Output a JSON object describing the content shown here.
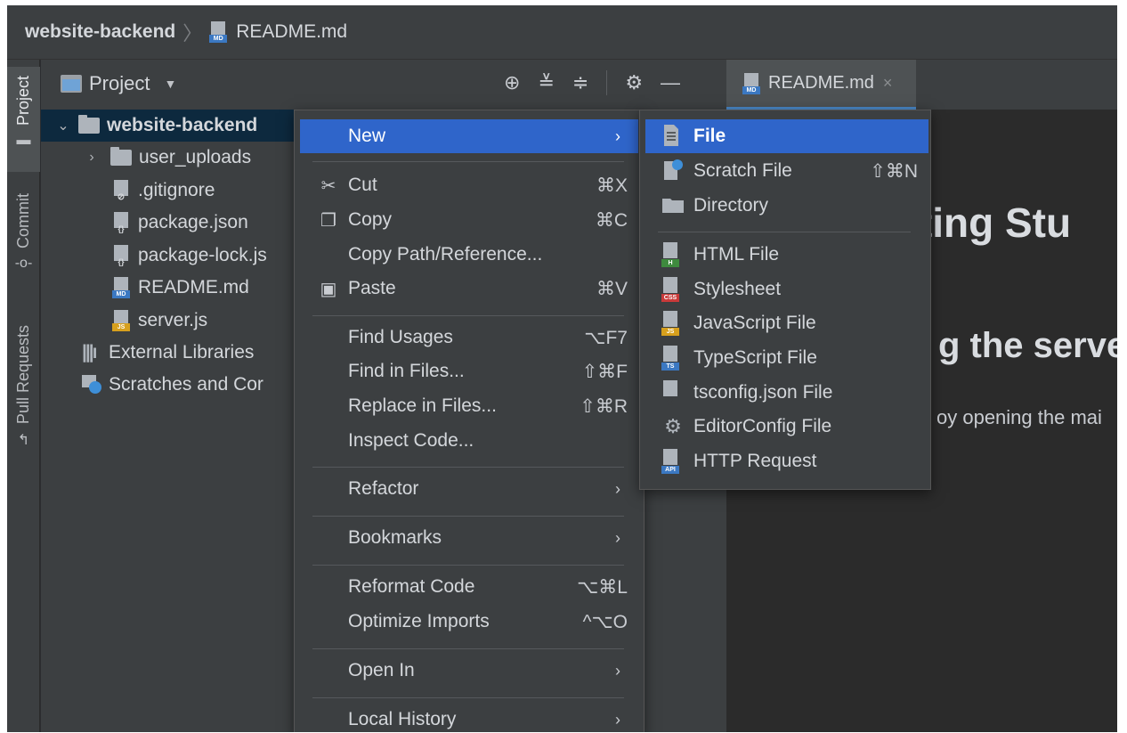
{
  "breadcrumb": {
    "root": "website-backend",
    "separator": "〉",
    "file": "README.md",
    "file_icon": "markdown-file-icon"
  },
  "stripe": {
    "project": "Project",
    "commit": "Commit",
    "pull_requests": "Pull Requests"
  },
  "project_panel": {
    "title": "Project",
    "tools": [
      "locate-icon",
      "expand-all-icon",
      "collapse-all-icon",
      "gear-icon",
      "hide-icon"
    ]
  },
  "tree": {
    "root": "website-backend",
    "items": [
      {
        "label": "user_uploads",
        "kind": "folder"
      },
      {
        "label": ".gitignore",
        "kind": "gitignore"
      },
      {
        "label": "package.json",
        "kind": "json"
      },
      {
        "label": "package-lock.js",
        "kind": "json"
      },
      {
        "label": "README.md",
        "kind": "md"
      },
      {
        "label": "server.js",
        "kind": "js"
      },
      {
        "label": "External Libraries",
        "kind": "libraries"
      },
      {
        "label": "Scratches and Cor",
        "kind": "scratches"
      }
    ]
  },
  "editor": {
    "tab_label": "README.md",
    "tab_close": "×",
    "h1": "rting Stu",
    "h2": "g the serve",
    "p": "oy opening the mai"
  },
  "context_menu": {
    "items": [
      {
        "label": "New",
        "shortcut": "",
        "submenu": true,
        "highlight": true,
        "icon": ""
      },
      {
        "label": "Cut",
        "shortcut": "⌘X",
        "icon": "✂"
      },
      {
        "label": "Copy",
        "shortcut": "⌘C",
        "icon": "❐"
      },
      {
        "label": "Copy Path/Reference...",
        "shortcut": "",
        "icon": ""
      },
      {
        "label": "Paste",
        "shortcut": "⌘V",
        "icon": "📋"
      },
      {
        "label": "Find Usages",
        "shortcut": "⌥F7",
        "icon": ""
      },
      {
        "label": "Find in Files...",
        "shortcut": "⇧⌘F",
        "icon": ""
      },
      {
        "label": "Replace in Files...",
        "shortcut": "⇧⌘R",
        "icon": ""
      },
      {
        "label": "Inspect Code...",
        "shortcut": "",
        "icon": ""
      },
      {
        "label": "Refactor",
        "shortcut": "",
        "submenu": true
      },
      {
        "label": "Bookmarks",
        "shortcut": "",
        "submenu": true
      },
      {
        "label": "Reformat Code",
        "shortcut": "⌥⌘L"
      },
      {
        "label": "Optimize Imports",
        "shortcut": "^⌥O"
      },
      {
        "label": "Open In",
        "shortcut": "",
        "submenu": true
      },
      {
        "label": "Local History",
        "shortcut": "",
        "submenu": true
      }
    ],
    "submenu_arrow": "›"
  },
  "new_submenu": {
    "items": [
      {
        "label": "File",
        "shortcut": "",
        "highlight": true,
        "icon": "file-icon"
      },
      {
        "label": "Scratch File",
        "shortcut": "⇧⌘N",
        "icon": "scratch-file-icon"
      },
      {
        "label": "Directory",
        "shortcut": "",
        "icon": "folder-icon"
      },
      {
        "label": "HTML File",
        "shortcut": "",
        "icon": "html-file-icon",
        "tag": "H",
        "tag_color": "#3e8a3e"
      },
      {
        "label": "Stylesheet",
        "shortcut": "",
        "icon": "css-file-icon",
        "tag": "CSS",
        "tag_color": "#c93a3a"
      },
      {
        "label": "JavaScript File",
        "shortcut": "",
        "icon": "js-file-icon",
        "tag": "JS",
        "tag_color": "#d7a01d"
      },
      {
        "label": "TypeScript File",
        "shortcut": "",
        "icon": "ts-file-icon",
        "tag": "TS",
        "tag_color": "#3b78c2"
      },
      {
        "label": "tsconfig.json File",
        "shortcut": "",
        "icon": "json-file-icon"
      },
      {
        "label": "EditorConfig File",
        "shortcut": "",
        "icon": "gear-icon"
      },
      {
        "label": "HTTP Request",
        "shortcut": "",
        "icon": "api-file-icon",
        "tag": "API",
        "tag_color": "#3b78c2"
      }
    ]
  },
  "colors": {
    "accent": "#2f65ca",
    "panel": "#3c3f41",
    "editor_bg": "#2b2b2b",
    "selection": "#0d293e"
  }
}
